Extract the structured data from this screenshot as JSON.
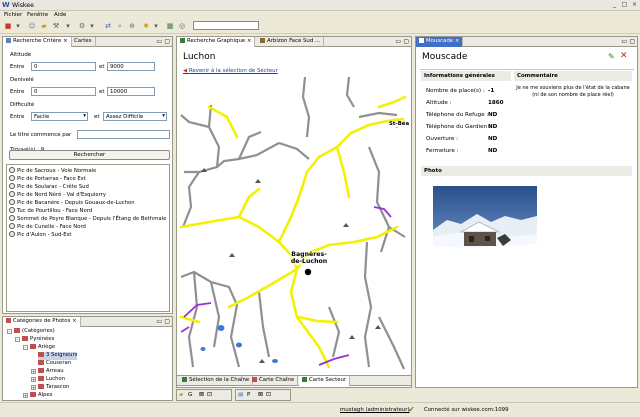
{
  "app": {
    "title": "Wiskee"
  },
  "menu": [
    "Fichier",
    "Fenêtre",
    "Aide"
  ],
  "left_tabs": [
    "Recherche Critère",
    "Cartes"
  ],
  "criteria": {
    "altitude": {
      "label": "Altitude",
      "from_label": "Entre",
      "from": "0",
      "and_label": "et",
      "to": "9000"
    },
    "denivele": {
      "label": "Denivelé",
      "from_label": "Entre",
      "from": "0",
      "and_label": "et",
      "to": "10000"
    },
    "difficulte": {
      "label": "Difficulté",
      "from_label": "Entre",
      "from": "Facile",
      "and_label": "et",
      "to": "Assez Difficile"
    },
    "title_label": "Le titre commence par",
    "found_label": "Trouvé(s) : 9",
    "search_button": "Rechercher"
  },
  "results": [
    "Pic de Sacroux - Voie Normale",
    "Pic de Portarras - Face Est",
    "Pic de Soularac - Crête Sud",
    "Pic de Nord Néré - Val d'Esquierry",
    "Pic de Bacanère - Depuis Gouaux-de-Luchon",
    "Tuc de Pourtillou - Face Nord",
    "Sommet de Peyre Blanque - Depuis l'Étang de Bethmale",
    "Pic de Cunelle - Face Nord",
    "Pic d'Aulon - Sud-Est"
  ],
  "categories": {
    "tab": "Catégories de Photos",
    "items": [
      {
        "label": "(Catégories)",
        "level": 0,
        "toggle": "-"
      },
      {
        "label": "Pyrénées",
        "level": 1,
        "toggle": "-"
      },
      {
        "label": "Ariège",
        "level": 2,
        "toggle": "-"
      },
      {
        "label": "3 Seigneurs",
        "level": 3,
        "toggle": "",
        "selected": true
      },
      {
        "label": "Couseran",
        "level": 3,
        "toggle": ""
      },
      {
        "label": "Arreau",
        "level": 2,
        "toggle": "+"
      },
      {
        "label": "Luchon",
        "level": 2,
        "toggle": "+"
      },
      {
        "label": "Tarascon",
        "level": 2,
        "toggle": "+"
      },
      {
        "label": "Alpes",
        "level": 1,
        "toggle": "+"
      }
    ]
  },
  "center_tabs": [
    "Recherche Graphique",
    "Arbizon Face Sud ..."
  ],
  "map": {
    "title": "Luchon",
    "back_link": "Revenir à la sélection de Secteur",
    "labels": {
      "town": "Bagnères-de-Luchon",
      "stbe": "St-Béa"
    }
  },
  "bottom_tabs": [
    "Sélection de la Chaîne",
    "Carte Chaîne",
    "Carte Secteur"
  ],
  "right": {
    "tab": "Mouscade",
    "title": "Mouscade",
    "general_header": "Informations générales",
    "comment_header": "Commentaire",
    "fields": [
      {
        "label": "Nombre de place(s) :",
        "value": "-1"
      },
      {
        "label": "Altitude :",
        "value": "1860"
      },
      {
        "label": "Téléphone du Refuge :",
        "value": "ND"
      },
      {
        "label": "Téléphone du Gardien :",
        "value": "ND"
      },
      {
        "label": "Ouverture :",
        "value": "ND"
      },
      {
        "label": "Fermeture :",
        "value": "ND"
      }
    ],
    "comment": "Je ne me souviens plus de l'état de la cabane (ni de son nombre de place réel)",
    "photo_header": "Photo"
  },
  "status": {
    "user": "mustagh (administrateur)",
    "connection": "Connecté sur wiskee.com:1099"
  },
  "colors": {
    "road": "#f2f200",
    "river": "#909090",
    "trail": "#9933cc",
    "lake": "#3a7bd5",
    "town": "#000000"
  }
}
